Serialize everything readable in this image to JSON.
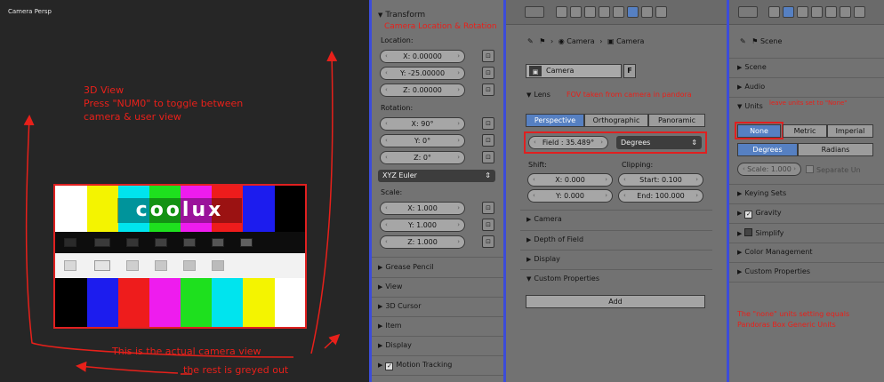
{
  "viewport": {
    "title": "Camera Persp",
    "note_lines": [
      "3D View",
      "Press \"NUM0\" to toggle between",
      "camera & user view"
    ],
    "annot_actual": "This is the actual camera view",
    "annot_greyed": "the rest is greyed out",
    "logo": "coolux",
    "colors": {
      "annotation": "#e8201a"
    }
  },
  "transform": {
    "header": "Transform",
    "annotation": "Camera Location & Rotation",
    "location_label": "Location:",
    "loc_x": "X: 0.00000",
    "loc_y": "Y: -25.00000",
    "loc_z": "Z: 0.00000",
    "rotation_label": "Rotation:",
    "rot_x": "X: 90°",
    "rot_y": "Y: 0°",
    "rot_z": "Z: 0°",
    "rot_mode": "XYZ Euler",
    "scale_label": "Scale:",
    "scale_x": "X: 1.000",
    "scale_y": "Y: 1.000",
    "scale_z": "Z: 1.000",
    "sections": [
      "Grease Pencil",
      "View",
      "3D Cursor",
      "Item",
      "Display",
      "Motion Tracking"
    ]
  },
  "camera": {
    "breadcrumb_obj": "Camera",
    "breadcrumb_data": "Camera",
    "datablock_name": "Camera",
    "fake_user": "F",
    "lens_header": "Lens",
    "lens_annotation": "FOV taken from camera in pandora",
    "tabs": [
      "Perspective",
      "Orthographic",
      "Panoramic"
    ],
    "field": "Field : 35.489°",
    "unit": "Degrees",
    "shift_label": "Shift:",
    "shift_x": "X: 0.000",
    "shift_y": "Y: 0.000",
    "clipping_label": "Clipping:",
    "clip_start": "Start: 0.100",
    "clip_end": "End: 100.000",
    "sections": [
      "Camera",
      "Depth of Field",
      "Display"
    ],
    "custom_header": "Custom Properties",
    "add_button": "Add"
  },
  "scene": {
    "breadcrumb": "Scene",
    "sections_top": [
      "Scene",
      "Audio"
    ],
    "units_header": "Units",
    "units_annotation": "leave units set to \"None\"",
    "unit_systems": [
      "None",
      "Metric",
      "Imperial"
    ],
    "rotation_units": [
      "Degrees",
      "Radians"
    ],
    "scale": "Scale: 1.000",
    "separate_units": "Separate Un",
    "sections_bottom": [
      "Keying Sets",
      "Gravity",
      "Simplify",
      "Color Management",
      "Custom Properties"
    ],
    "bottom_annotation": [
      "The \"none\" units setting equals",
      "Pandoras Box Generic Units"
    ]
  }
}
